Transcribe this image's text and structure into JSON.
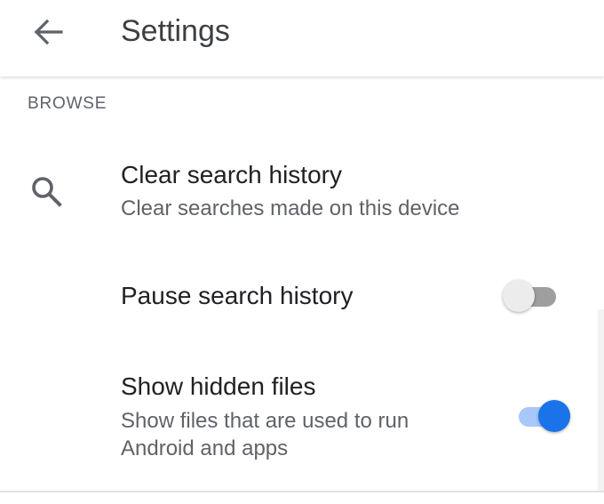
{
  "header": {
    "title": "Settings",
    "back_icon": "arrow-left-icon"
  },
  "section": {
    "header": "BROWSE"
  },
  "items": [
    {
      "title": "Clear search history",
      "subtitle": "Clear searches made on this device",
      "icon": "search-icon"
    },
    {
      "title": "Pause search history",
      "toggle_on": false
    },
    {
      "title": "Show hidden files",
      "subtitle_line1": "Show files that are used to run",
      "subtitle_line2": "Android and apps",
      "toggle_on": true
    }
  ],
  "colors": {
    "accent": "#1a73e8",
    "accent_track": "#a8c7fa",
    "switch_off_thumb": "#ececec",
    "switch_off_track": "#9e9e9e"
  }
}
